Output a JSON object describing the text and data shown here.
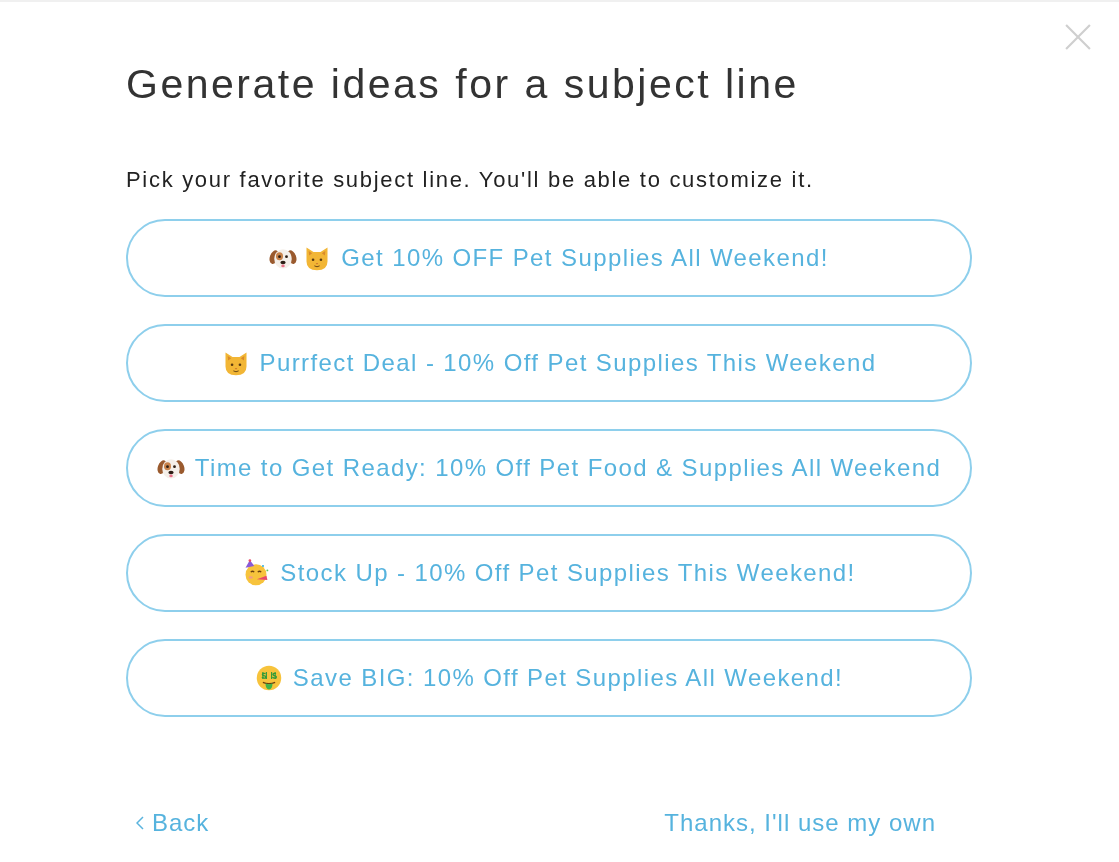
{
  "dialog": {
    "title": "Generate ideas for a subject line",
    "instruction": "Pick your favorite subject line. You'll be able to customize it."
  },
  "options": [
    {
      "icons": [
        {
          "kind": "dog"
        },
        {
          "kind": "cat"
        }
      ],
      "label": "Get 10% OFF Pet Supplies All Weekend!",
      "selected": false
    },
    {
      "icons": [
        {
          "kind": "cat"
        }
      ],
      "label": "Purrfect Deal - 10% Off Pet Supplies This Weekend",
      "selected": false
    },
    {
      "icons": [
        {
          "kind": "dog"
        }
      ],
      "label": "Time to Get Ready: 10% Off Pet Food & Supplies All Weekend",
      "selected": false
    },
    {
      "icons": [
        {
          "kind": "party"
        }
      ],
      "label": "Stock Up - 10% Off Pet Supplies This Weekend!",
      "selected": false
    },
    {
      "icons": [
        {
          "kind": "money"
        }
      ],
      "label": "Save BIG: 10% Off Pet Supplies All Weekend!",
      "selected": false
    }
  ],
  "footer": {
    "back": "Back",
    "own": "Thanks, I'll use my own"
  }
}
